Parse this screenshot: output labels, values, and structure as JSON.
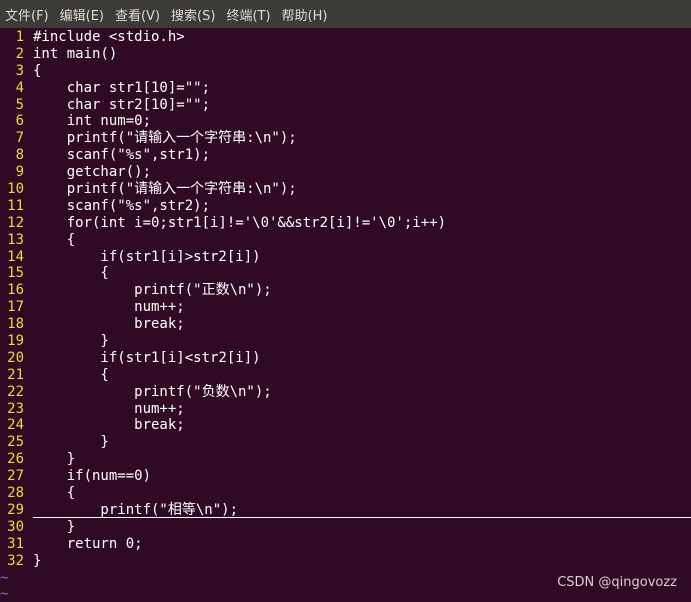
{
  "menu": [
    {
      "label": "文件(F)"
    },
    {
      "label": "编辑(E)"
    },
    {
      "label": "查看(V)"
    },
    {
      "label": "搜索(S)"
    },
    {
      "label": "终端(T)"
    },
    {
      "label": "帮助(H)"
    }
  ],
  "lines": [
    {
      "num": "1",
      "code": "#include <stdio.h>"
    },
    {
      "num": "2",
      "code": "int main()"
    },
    {
      "num": "3",
      "code": "{"
    },
    {
      "num": "4",
      "code": "    char str1[10]=\"\";"
    },
    {
      "num": "5",
      "code": "    char str2[10]=\"\";"
    },
    {
      "num": "6",
      "code": "    int num=0;"
    },
    {
      "num": "7",
      "code": "    printf(\"请输入一个字符串:\\n\");"
    },
    {
      "num": "8",
      "code": "    scanf(\"%s\",str1);"
    },
    {
      "num": "9",
      "code": "    getchar();"
    },
    {
      "num": "10",
      "code": "    printf(\"请输入一个字符串:\\n\");"
    },
    {
      "num": "11",
      "code": "    scanf(\"%s\",str2);"
    },
    {
      "num": "12",
      "code": "    for(int i=0;str1[i]!='\\0'&&str2[i]!='\\0';i++)"
    },
    {
      "num": "13",
      "code": "    {"
    },
    {
      "num": "14",
      "code": "        if(str1[i]>str2[i])"
    },
    {
      "num": "15",
      "code": "        {"
    },
    {
      "num": "16",
      "code": "            printf(\"正数\\n\");"
    },
    {
      "num": "17",
      "code": "            num++;"
    },
    {
      "num": "18",
      "code": "            break;"
    },
    {
      "num": "19",
      "code": "        }"
    },
    {
      "num": "20",
      "code": "        if(str1[i]<str2[i])"
    },
    {
      "num": "21",
      "code": "        {"
    },
    {
      "num": "22",
      "code": "            printf(\"负数\\n\");"
    },
    {
      "num": "23",
      "code": "            num++;"
    },
    {
      "num": "24",
      "code": "            break;"
    },
    {
      "num": "25",
      "code": "        }"
    },
    {
      "num": "26",
      "code": "    }"
    },
    {
      "num": "27",
      "code": "    if(num==0)"
    },
    {
      "num": "28",
      "code": "    {"
    },
    {
      "num": "29",
      "code": "        printf(\"相等\\n\");"
    },
    {
      "num": "30",
      "code": "    }"
    },
    {
      "num": "31",
      "code": "    return 0;"
    },
    {
      "num": "32",
      "code": "}"
    }
  ],
  "empty_marker": "~",
  "watermark": "CSDN @qingovozz",
  "colors": {
    "background": "#300a24",
    "menubar": "#3c3b37",
    "line_number": "#f0d83a",
    "code_text": "#ffffff"
  }
}
